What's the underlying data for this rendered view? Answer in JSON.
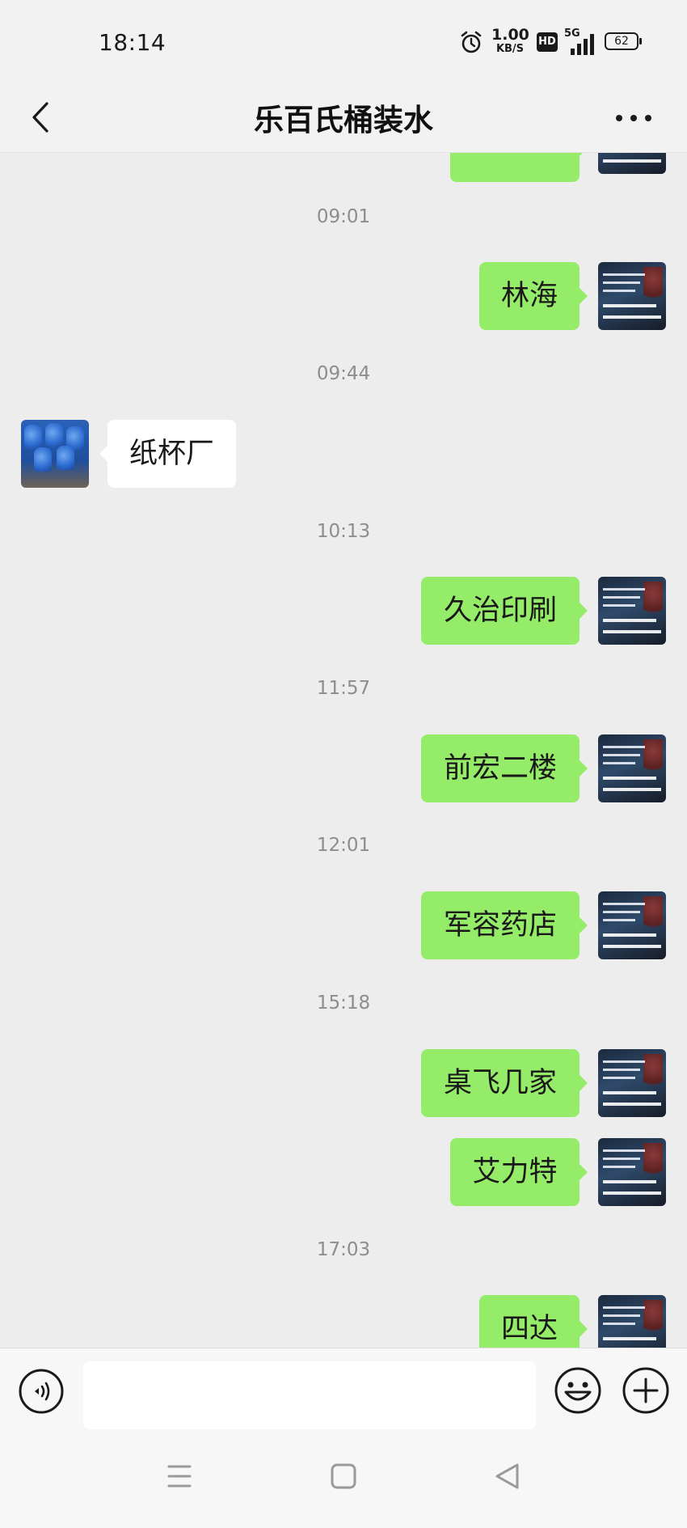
{
  "status_bar": {
    "time": "18:14",
    "net_speed_value": "1.00",
    "net_speed_unit": "KB/S",
    "hd_label": "HD",
    "network_label": "5G",
    "battery": "62"
  },
  "header": {
    "title": "乐百氏桶装水"
  },
  "messages": [
    {
      "type": "time",
      "text": "09:01"
    },
    {
      "type": "msg",
      "side": "out",
      "text": "林海"
    },
    {
      "type": "time",
      "text": "09:44"
    },
    {
      "type": "msg",
      "side": "in",
      "text": "纸杯厂"
    },
    {
      "type": "time",
      "text": "10:13"
    },
    {
      "type": "msg",
      "side": "out",
      "text": "久治印刷"
    },
    {
      "type": "time",
      "text": "11:57"
    },
    {
      "type": "msg",
      "side": "out",
      "text": "前宏二楼"
    },
    {
      "type": "time",
      "text": "12:01"
    },
    {
      "type": "msg",
      "side": "out",
      "text": "军容药店"
    },
    {
      "type": "time",
      "text": "15:18"
    },
    {
      "type": "msg",
      "side": "out",
      "text": "桌飞几家"
    },
    {
      "type": "msg",
      "side": "out",
      "text": "艾力特"
    },
    {
      "type": "time",
      "text": "17:03"
    },
    {
      "type": "msg",
      "side": "out",
      "text": "四达"
    }
  ],
  "input": {
    "value": "",
    "placeholder": ""
  },
  "icons": {
    "back": "chevron-left-icon",
    "more": "more-dots-icon",
    "voice": "voice-icon",
    "emoji": "emoji-icon",
    "plus": "plus-icon",
    "nav_menu": "menu-icon",
    "nav_home": "home-square-icon",
    "nav_back": "back-triangle-icon"
  },
  "colors": {
    "outgoing_bubble": "#95ec69",
    "incoming_bubble": "#ffffff",
    "chat_background": "#ededed"
  }
}
